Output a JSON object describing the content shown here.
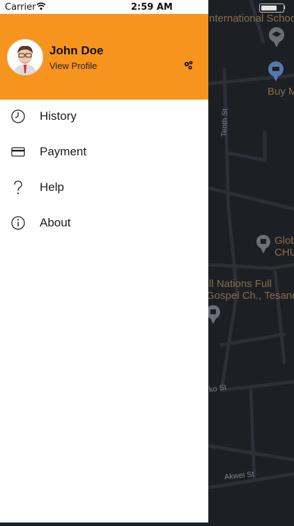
{
  "status_bar": {
    "carrier": "Carrier",
    "time": "2:59 AM"
  },
  "map": {
    "labels": {
      "school": "nternational School",
      "buy": "Buy M",
      "tenth_st": "Tenth St",
      "globe_line1": "Glob",
      "globe_line2": "CHU",
      "church_line1": "ll Nations Full",
      "church_line2": "Gospel Ch., Tesano",
      "ko_st": "ko St",
      "akwei_st": "Akwei St"
    },
    "colors": {
      "background": "#1c1f24",
      "road": "#2b3038",
      "label": "#8a6d4c"
    }
  },
  "drawer": {
    "header_color": "#f7941d",
    "user": {
      "name": "John Doe",
      "view_profile": "View Profile"
    },
    "menu": [
      {
        "label": "History",
        "icon": "clock-icon"
      },
      {
        "label": "Payment",
        "icon": "credit-card-icon"
      },
      {
        "label": "Help",
        "icon": "question-mark-icon"
      },
      {
        "label": "About",
        "icon": "info-icon"
      }
    ]
  }
}
